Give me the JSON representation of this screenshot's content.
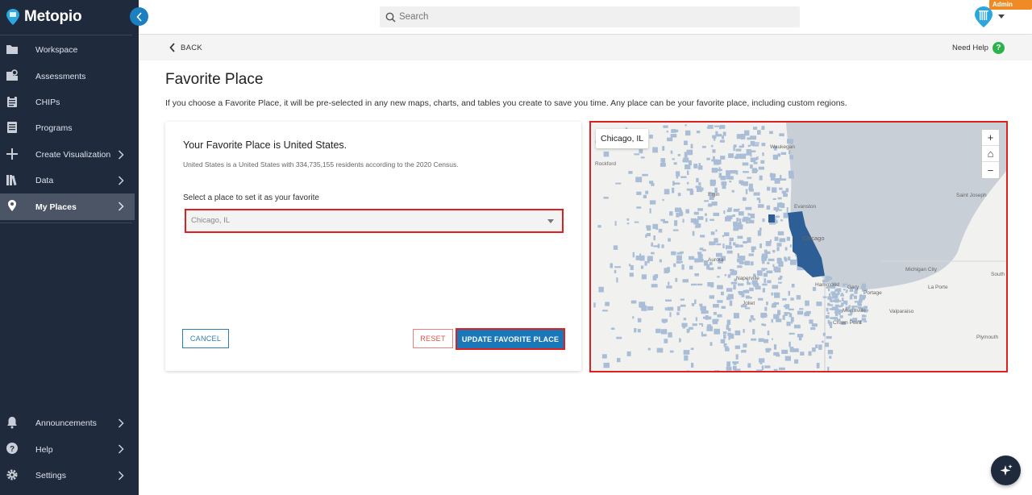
{
  "app": {
    "brand": "Metopio",
    "admin_mode": "Admin Mode"
  },
  "sidebar": {
    "items": [
      {
        "label": "Workspace",
        "icon": "folder-icon"
      },
      {
        "label": "Assessments",
        "icon": "assessment-icon"
      },
      {
        "label": "CHIPs",
        "icon": "clipboard-icon"
      },
      {
        "label": "Programs",
        "icon": "document-icon"
      },
      {
        "label": "Create Visualization",
        "icon": "plus-icon"
      },
      {
        "label": "Data",
        "icon": "books-icon"
      },
      {
        "label": "My Places",
        "icon": "location-pin-icon"
      }
    ],
    "bottom_items": [
      {
        "label": "Announcements",
        "icon": "bell-icon"
      },
      {
        "label": "Help",
        "icon": "question-icon"
      },
      {
        "label": "Settings",
        "icon": "gear-icon"
      }
    ]
  },
  "topbar": {
    "search_placeholder": "Search"
  },
  "subheader": {
    "back_label": "BACK",
    "need_help_label": "Need Help",
    "help_symbol": "?"
  },
  "page": {
    "title": "Favorite Place",
    "description": "If you choose a Favorite Place, it will be pre-selected in any new maps, charts, and tables you create to save you time. Any place can be your favorite place, including custom regions."
  },
  "card": {
    "heading": "Your Favorite Place is United States.",
    "subtext": "United States is a United States with 334,735,155 residents according to the 2020 Census.",
    "select_label": "Select a place to set it as your favorite",
    "select_value": "Chicago, IL",
    "cancel_label": "CANCEL",
    "reset_label": "RESET",
    "update_label": "UPDATE FAVORITE PLACE"
  },
  "map": {
    "tooltip": "Chicago, IL",
    "zoom_in": "+",
    "home": "⌂",
    "zoom_out": "−",
    "labels": [
      "Waukegan",
      "Rockford",
      "Saint Joseph",
      "Evanston",
      "Chicago",
      "Michigan City",
      "South",
      "Gary",
      "La Porte",
      "Hammond",
      "Portage",
      "Valparaiso",
      "Crown Point",
      "Merrillville",
      "Joliet",
      "Aurora",
      "Naperville",
      "Elgin",
      "Plymouth"
    ],
    "colors": {
      "water": "#c9cfd6",
      "land": "#f1f1ef",
      "urban": "#a9bdd6",
      "selected": "#2d5f96"
    }
  }
}
